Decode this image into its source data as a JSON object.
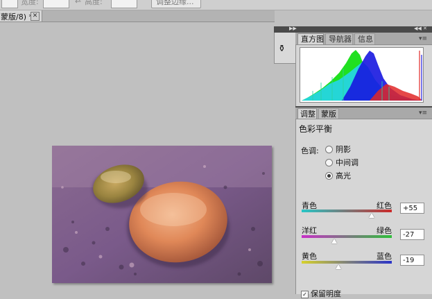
{
  "options_bar": {
    "label_a": "宽度:",
    "label_b": "高度:",
    "button": "调整边缘..."
  },
  "document": {
    "tab_title": "蒙版/8) *",
    "close_glyph": "✕"
  },
  "histogram_panel": {
    "tabs": [
      "直方图",
      "导航器",
      "信息"
    ],
    "active_tab": "直方图"
  },
  "adjustments_panel": {
    "tabs": [
      "调整",
      "蒙版"
    ],
    "active_tab": "调整",
    "title": "色彩平衡",
    "tone_label": "色调:",
    "tones": [
      {
        "label": "阴影",
        "selected": false
      },
      {
        "label": "中间调",
        "selected": false
      },
      {
        "label": "高光",
        "selected": true
      }
    ],
    "sliders": [
      {
        "left": "青色",
        "right": "红色",
        "value": "+55",
        "level": 0.775,
        "gradient": [
          "#27c6c6",
          "#cc2a2a"
        ]
      },
      {
        "left": "洋红",
        "right": "绿色",
        "value": "-27",
        "level": 0.365,
        "gradient": [
          "#c830c8",
          "#2fbf3a"
        ]
      },
      {
        "left": "黄色",
        "right": "蓝色",
        "value": "-19",
        "level": 0.405,
        "gradient": [
          "#d6d12c",
          "#2b34c8"
        ]
      }
    ],
    "preserve_luminosity": "保留明度"
  },
  "icons": {
    "dock_collapse": "double-arrow-right-icon",
    "dock_expand": "double-arrow-left-icon",
    "panel_menu": "panel-menu-icon",
    "tool_preset": "clone-stamp-icon"
  },
  "colors": {
    "workspace": "#c0c0c0",
    "panel": "#d6d6d6",
    "dock_header": "#4a4a4a"
  }
}
